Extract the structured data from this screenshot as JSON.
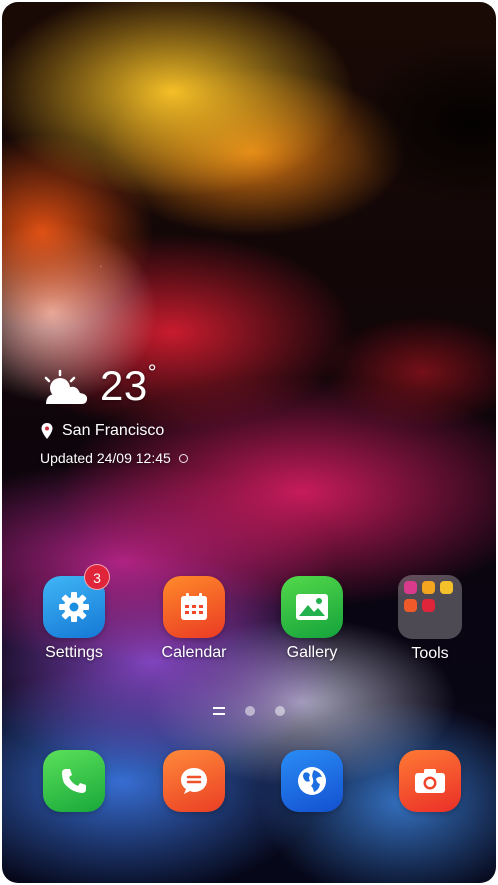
{
  "weather": {
    "icon": "partly-cloudy-icon",
    "temperature": "23",
    "unit": "°",
    "location": "San Francisco",
    "updated": "Updated 24/09 12:45"
  },
  "apps": [
    {
      "label": "Settings",
      "icon": "gear-icon",
      "color": "#1a8fe0",
      "badge": "3"
    },
    {
      "label": "Calendar",
      "icon": "calendar-icon",
      "color": "#f1472a"
    },
    {
      "label": "Gallery",
      "icon": "image-icon",
      "color": "#22b14c"
    },
    {
      "label": "Tools",
      "icon": "folder-icon"
    }
  ],
  "dock": [
    {
      "icon": "phone-icon",
      "color": "#2fc24a"
    },
    {
      "icon": "message-icon",
      "color": "#f0502a"
    },
    {
      "icon": "globe-icon",
      "color": "#1b6fe0"
    },
    {
      "icon": "camera-icon",
      "color": "#f0442c"
    }
  ]
}
